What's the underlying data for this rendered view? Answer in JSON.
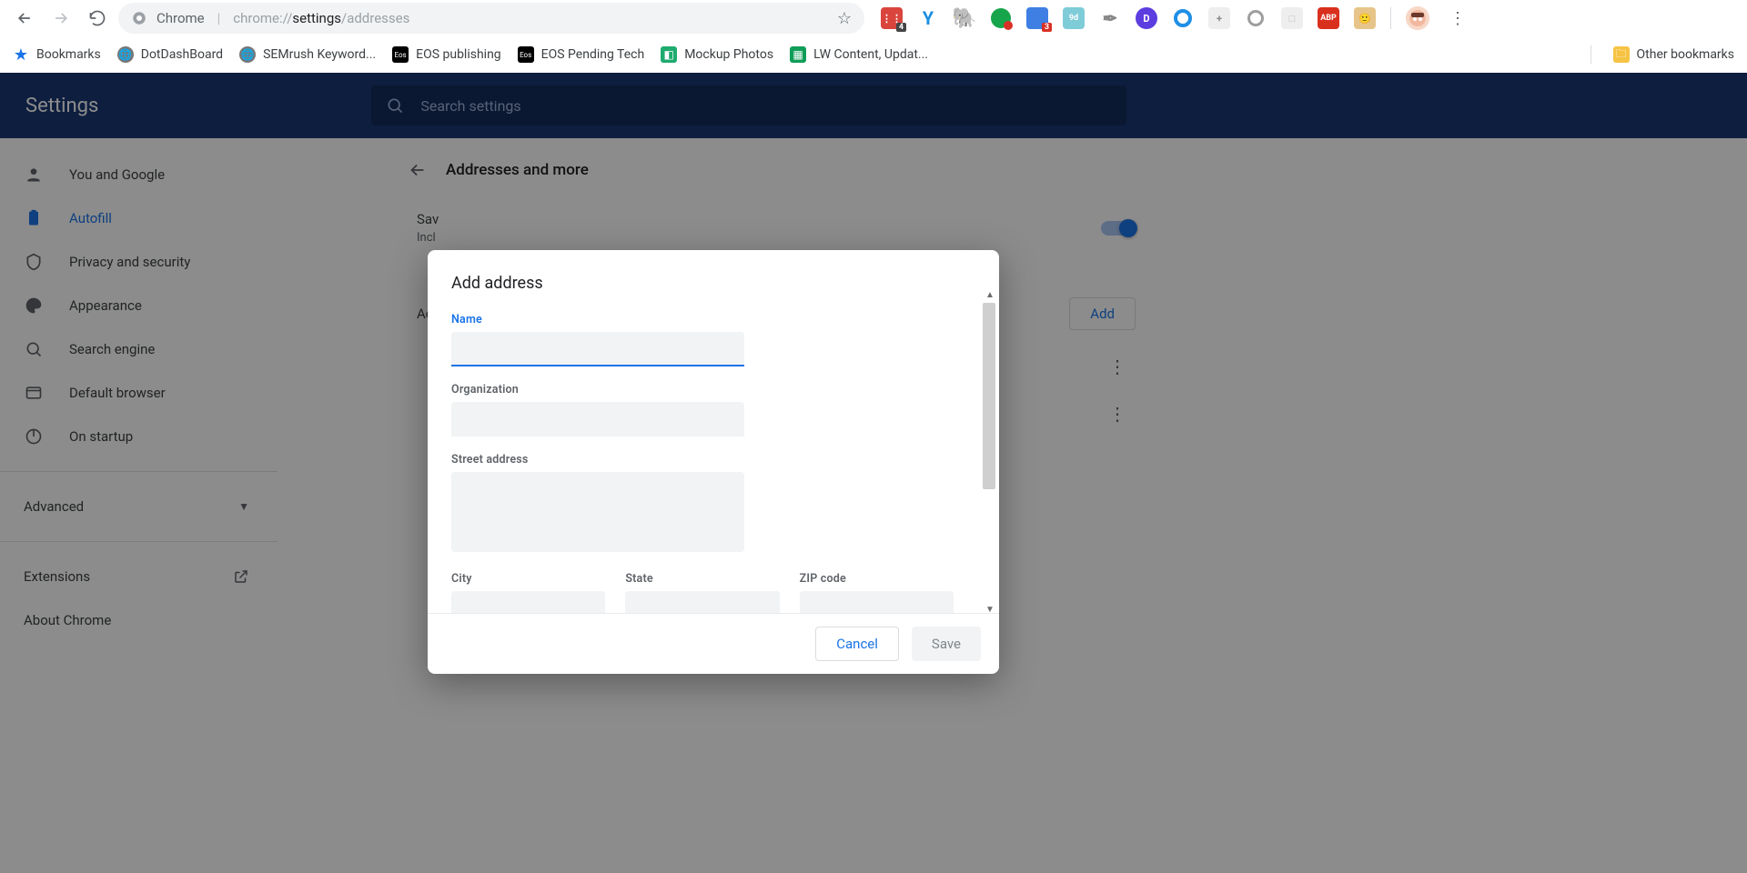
{
  "browser": {
    "omnibox": {
      "scheme_label": "Chrome",
      "url_pre": "chrome://",
      "url_bold": "settings",
      "url_post": "/addresses"
    },
    "extensions_badges": {
      "ext0": "4",
      "ext5": "3",
      "ext6": "9d"
    }
  },
  "bookmarks": {
    "items": [
      {
        "label": "Bookmarks"
      },
      {
        "label": "DotDashBoard"
      },
      {
        "label": "SEMrush Keyword..."
      },
      {
        "label": "EOS publishing"
      },
      {
        "label": "EOS Pending Tech"
      },
      {
        "label": "Mockup Photos"
      },
      {
        "label": "LW Content, Updat..."
      }
    ],
    "other_label": "Other bookmarks"
  },
  "settings": {
    "title": "Settings",
    "search_placeholder": "Search settings",
    "sidebar": {
      "items": [
        {
          "label": "You and Google"
        },
        {
          "label": "Autofill"
        },
        {
          "label": "Privacy and security"
        },
        {
          "label": "Appearance"
        },
        {
          "label": "Search engine"
        },
        {
          "label": "Default browser"
        },
        {
          "label": "On startup"
        }
      ],
      "advanced": "Advanced",
      "extensions": "Extensions",
      "about": "About Chrome"
    },
    "page": {
      "heading": "Addresses and more",
      "save_row": {
        "title": "Sav",
        "sub": "Incl"
      },
      "addresses_label": "Add",
      "add_button": "Add"
    }
  },
  "dialog": {
    "title": "Add address",
    "fields": {
      "name": "Name",
      "organization": "Organization",
      "street": "Street address",
      "city": "City",
      "state": "State",
      "zip": "ZIP code"
    },
    "cancel": "Cancel",
    "save": "Save"
  }
}
